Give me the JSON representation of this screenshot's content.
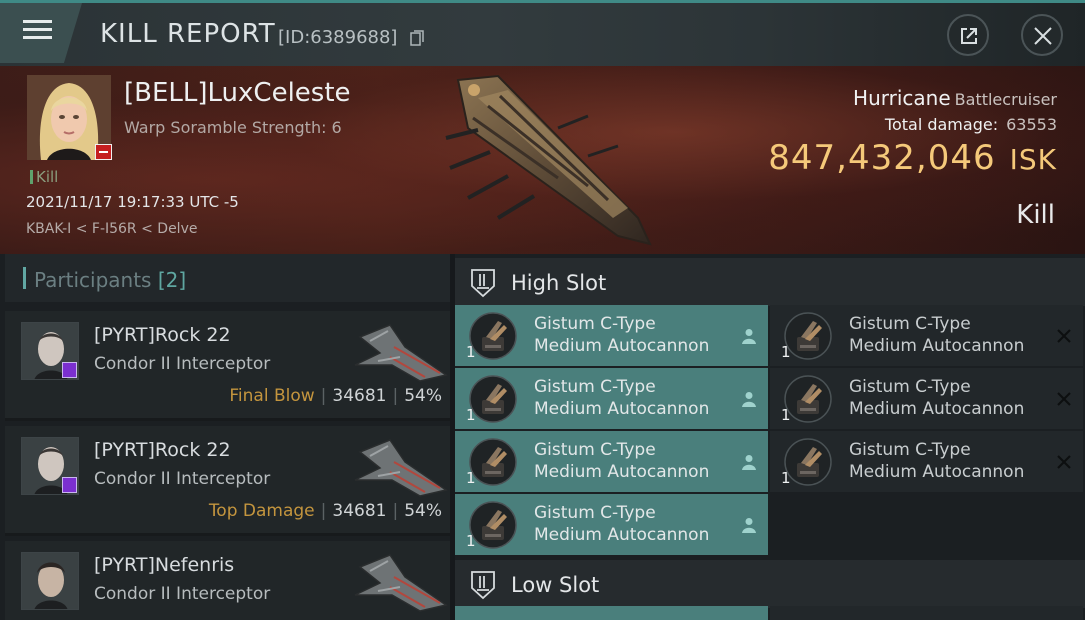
{
  "header": {
    "title": "KILL REPORT",
    "id_label": "[ID:6389688]",
    "icons": {
      "menu": "hamburger-icon",
      "copy": "copy-icon",
      "external": "external-link-icon",
      "close": "close-icon"
    }
  },
  "victim": {
    "name": "[BELL]LuxCeleste",
    "subtitle": "Warp Soramble Strength: 6",
    "kill_tag": "Kill",
    "timestamp": "2021/11/17 19:17:33 UTC -5",
    "location": "KBAK-I < F-I56R < Delve",
    "ship_name": "Hurricane",
    "ship_class": "Battlecruiser",
    "total_damage_label": "Total damage:",
    "total_damage": "63553",
    "isk_value": "847,432,046",
    "isk_unit": "ISK",
    "kill_type": "Kill",
    "badge_color": "#c51f20"
  },
  "participants": {
    "label": "Participants",
    "count": "[2]",
    "items": [
      {
        "name": "[PYRT]Rock 22",
        "ship": "Condor II Interceptor",
        "role": "Final Blow",
        "damage": "34681",
        "percent": "54%"
      },
      {
        "name": "[PYRT]Rock 22",
        "ship": "Condor II Interceptor",
        "role": "Top Damage",
        "damage": "34681",
        "percent": "54%"
      },
      {
        "name": "[PYRT]Nefenris",
        "ship": "Condor II Interceptor",
        "role": "",
        "damage": "",
        "percent": ""
      }
    ]
  },
  "fitting": {
    "high_slot_label": "High Slot",
    "low_slot_label": "Low Slot",
    "high_slot": [
      {
        "qty": "1",
        "line1": "Gistum C-Type",
        "line2": "Medium Autocannon",
        "status": "dropped"
      },
      {
        "qty": "1",
        "line1": "Gistum C-Type",
        "line2": "Medium Autocannon",
        "status": "dropped"
      },
      {
        "qty": "1",
        "line1": "Gistum C-Type",
        "line2": "Medium Autocannon",
        "status": "dropped"
      },
      {
        "qty": "1",
        "line1": "Gistum C-Type",
        "line2": "Medium Autocannon",
        "status": "destroyed"
      },
      {
        "qty": "1",
        "line1": "Gistum C-Type",
        "line2": "Medium Autocannon",
        "status": "destroyed"
      },
      {
        "qty": "1",
        "line1": "Gistum C-Type",
        "line2": "Medium Autocannon",
        "status": "destroyed"
      },
      {
        "qty": "1",
        "line1": "Gistum C-Type",
        "line2": "Medium Autocannon",
        "status": "dropped"
      }
    ]
  },
  "colors": {
    "accent": "#4a7f7c",
    "isk": "#f5c97a",
    "role": "#c4953e"
  }
}
